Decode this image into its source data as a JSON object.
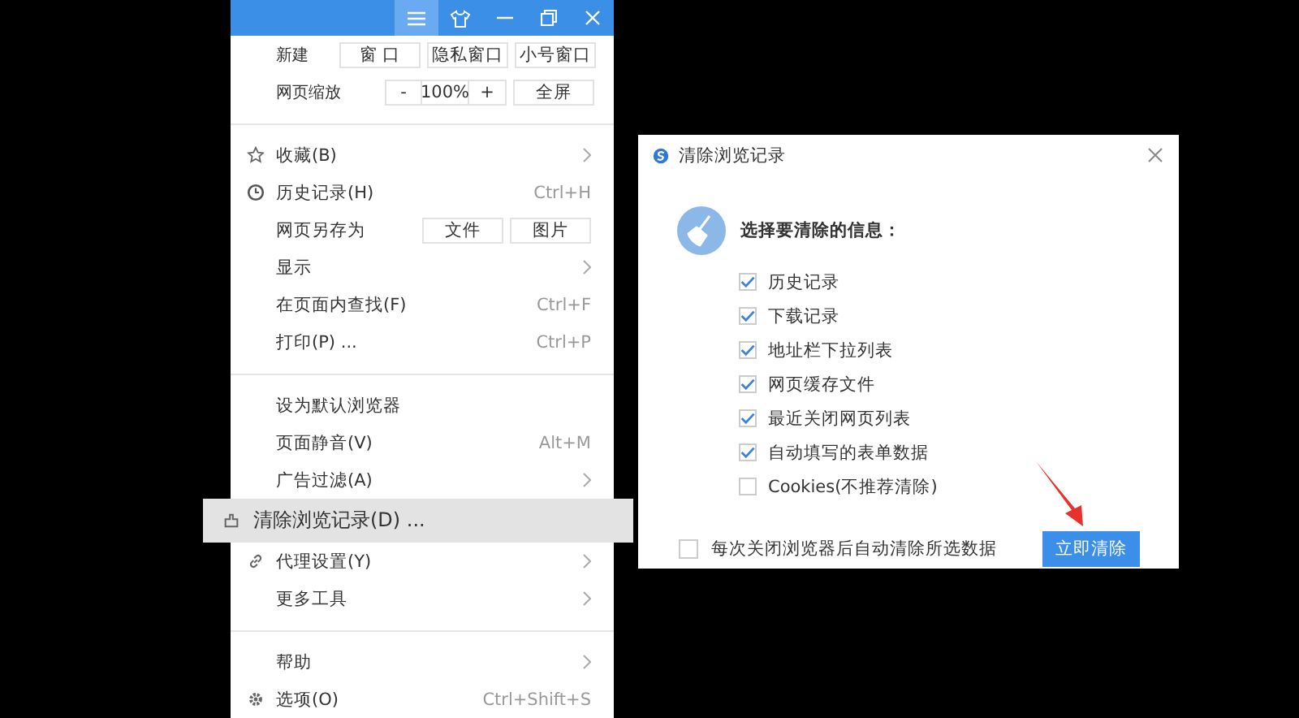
{
  "menu": {
    "quick_rows": [
      {
        "kind": "buttons",
        "label": "新建",
        "buttons": [
          "窗 口",
          "隐私窗口",
          "小号窗口"
        ]
      },
      {
        "kind": "zoom",
        "label": "网页缩放",
        "minus": "-",
        "value": "100%",
        "plus": "+",
        "button": "全屏"
      }
    ],
    "groups": [
      [
        {
          "label": "收藏(B)",
          "submenu": true,
          "selected": false
        },
        {
          "label": "历史记录(H)",
          "shortcut": "Ctrl+H",
          "submenu": false,
          "selected": false
        },
        {
          "label": "网页另存为",
          "buttons": [
            "文件",
            "图片"
          ],
          "submenu": false,
          "selected": false
        },
        {
          "label": "显示",
          "submenu": true,
          "selected": false
        },
        {
          "label": "在页面内查找(F)",
          "shortcut": "Ctrl+F",
          "submenu": false,
          "selected": false
        },
        {
          "label": "打印(P) ...",
          "shortcut": "Ctrl+P",
          "submenu": false,
          "selected": false
        }
      ],
      [
        {
          "label": "设为默认浏览器",
          "submenu": false,
          "selected": false
        },
        {
          "label": "页面静音(V)",
          "shortcut": "Alt+M",
          "submenu": false,
          "selected": false
        },
        {
          "label": "广告过滤(A)",
          "submenu": true,
          "selected": false
        },
        {
          "label": "清除浏览记录(D) ...",
          "submenu": false,
          "selected": true
        },
        {
          "label": "代理设置(Y)",
          "submenu": true,
          "selected": false
        },
        {
          "label": "更多工具",
          "submenu": true,
          "selected": false
        }
      ],
      [
        {
          "label": "帮助",
          "submenu": true,
          "selected": false
        },
        {
          "label": "选项(O)",
          "shortcut": "Ctrl+Shift+S",
          "submenu": false,
          "selected": false
        }
      ]
    ]
  },
  "dialog": {
    "title": "清除浏览记录",
    "heading": "选择要清除的信息：",
    "options": [
      {
        "label": "历史记录",
        "checked": true
      },
      {
        "label": "下载记录",
        "checked": true
      },
      {
        "label": "地址栏下拉列表",
        "checked": true
      },
      {
        "label": "网页缓存文件",
        "checked": true
      },
      {
        "label": "最近关闭网页列表",
        "checked": true
      },
      {
        "label": "自动填写的表单数据",
        "checked": true
      },
      {
        "label": "Cookies(不推荐清除)",
        "checked": false
      }
    ],
    "auto_clear": {
      "label": "每次关闭浏览器后自动清除所选数据",
      "checked": false
    },
    "button": "立即清除"
  }
}
